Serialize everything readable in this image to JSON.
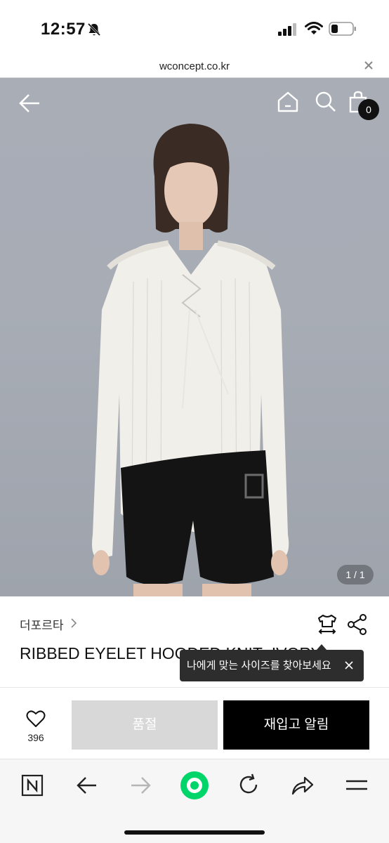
{
  "status_bar": {
    "time": "12:57"
  },
  "browser": {
    "url": "wconcept.co.kr"
  },
  "header": {
    "cart_count": "0"
  },
  "gallery": {
    "page_indicator": "1 / 1"
  },
  "product": {
    "brand": "더포르타",
    "title": "RIBBED EYELET HOODED KNIT_IVORY",
    "like_count": "396"
  },
  "tooltip": {
    "text": "나에게 맞는 사이즈를 찾아보세요"
  },
  "actions": {
    "soldout_label": "품절",
    "restock_label": "재입고 알림"
  },
  "colors": {
    "accent_green": "#00d56a",
    "button_black": "#000000",
    "button_disabled": "#d8d8d8"
  }
}
